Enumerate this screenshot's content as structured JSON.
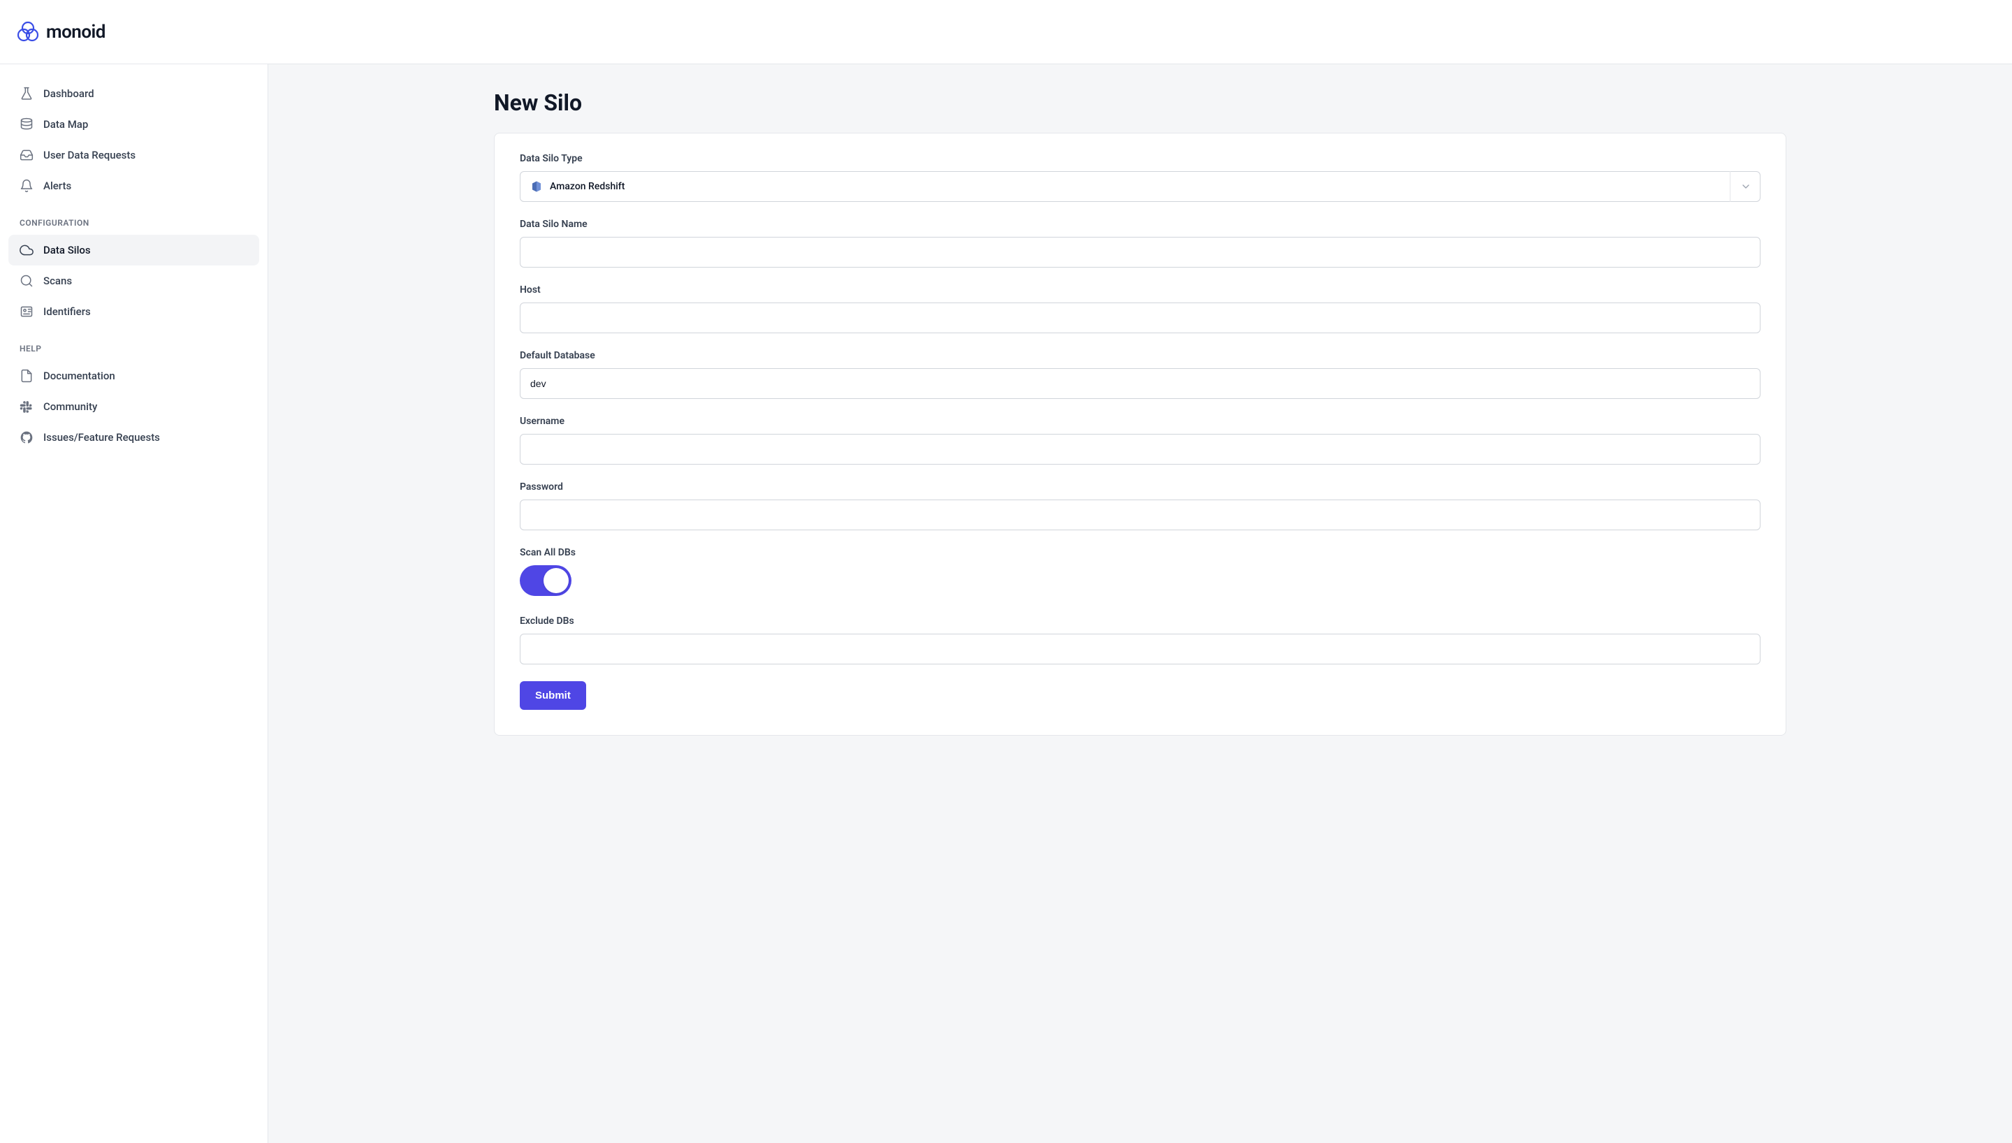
{
  "brand": {
    "name": "monoid"
  },
  "sidebar": {
    "primary": [
      {
        "label": "Dashboard",
        "icon": "flask"
      },
      {
        "label": "Data Map",
        "icon": "database"
      },
      {
        "label": "User Data Requests",
        "icon": "inbox"
      },
      {
        "label": "Alerts",
        "icon": "bell"
      }
    ],
    "configuration_header": "CONFIGURATION",
    "configuration": [
      {
        "label": "Data Silos",
        "icon": "cloud",
        "active": true
      },
      {
        "label": "Scans",
        "icon": "search"
      },
      {
        "label": "Identifiers",
        "icon": "idcard"
      }
    ],
    "help_header": "HELP",
    "help": [
      {
        "label": "Documentation",
        "icon": "document"
      },
      {
        "label": "Community",
        "icon": "slack"
      },
      {
        "label": "Issues/Feature Requests",
        "icon": "github"
      }
    ]
  },
  "page": {
    "title": "New Silo"
  },
  "form": {
    "silo_type": {
      "label": "Data Silo Type",
      "selected": "Amazon Redshift"
    },
    "silo_name": {
      "label": "Data Silo Name",
      "value": ""
    },
    "host": {
      "label": "Host",
      "value": ""
    },
    "default_db": {
      "label": "Default Database",
      "value": "dev"
    },
    "username": {
      "label": "Username",
      "value": ""
    },
    "password": {
      "label": "Password",
      "value": ""
    },
    "scan_all": {
      "label": "Scan All DBs",
      "value": true
    },
    "exclude_dbs": {
      "label": "Exclude DBs",
      "value": ""
    },
    "submit": "Submit"
  }
}
